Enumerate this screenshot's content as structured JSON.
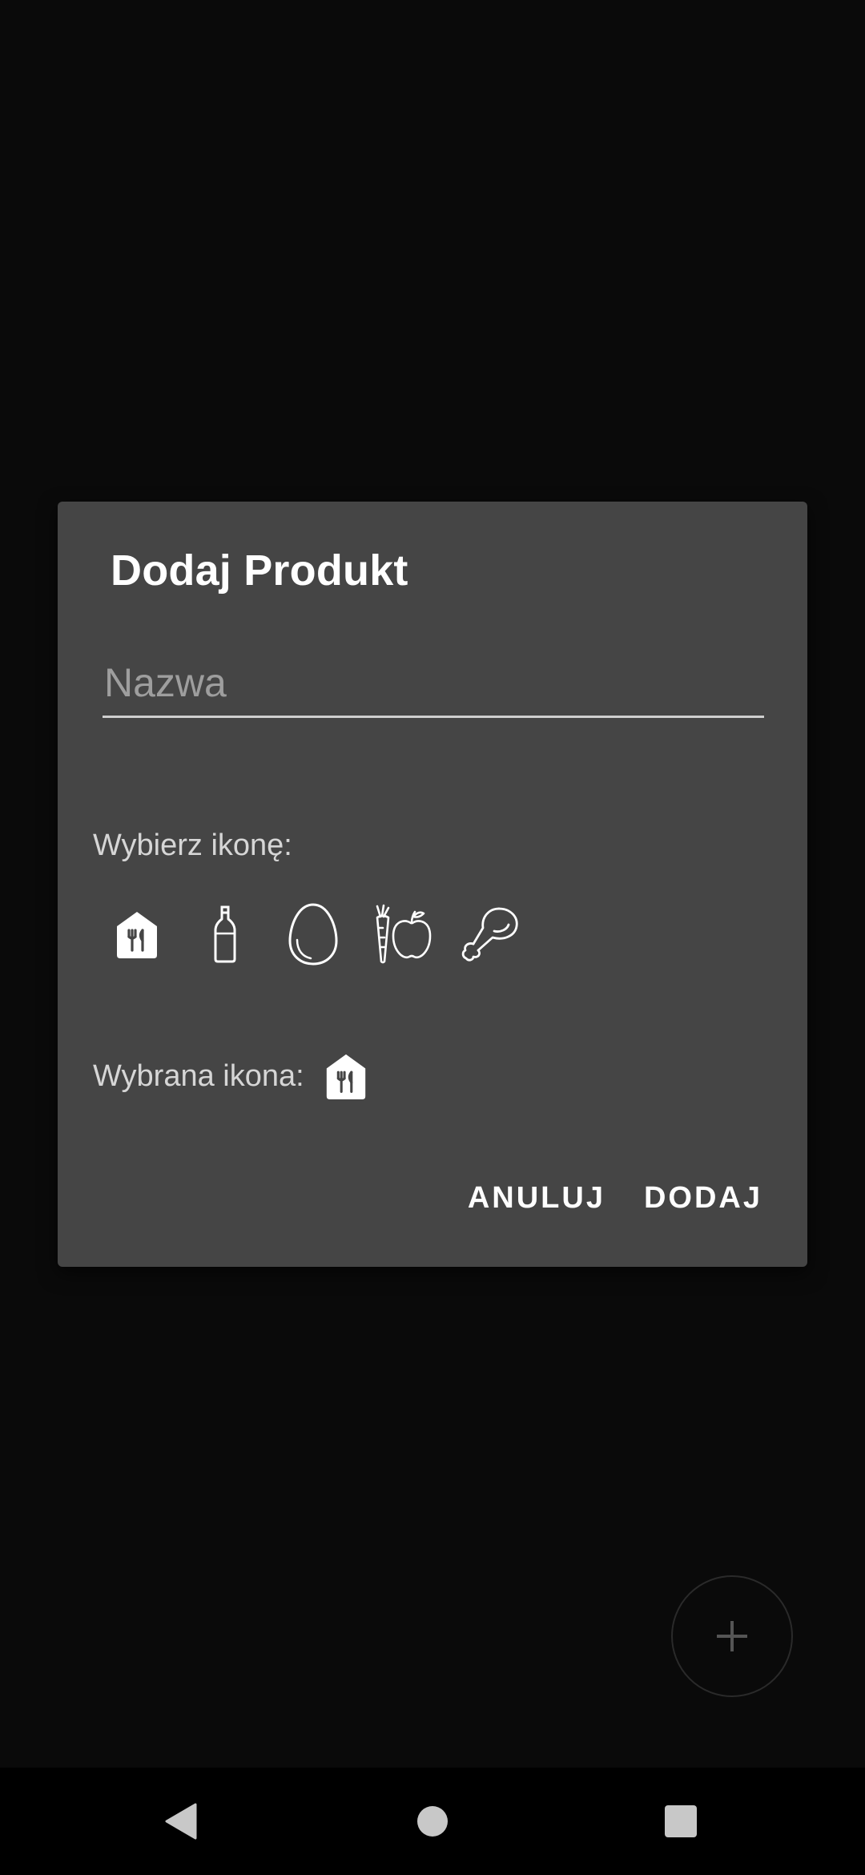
{
  "dialog": {
    "title": "Dodaj Produkt",
    "name_placeholder": "Nazwa",
    "name_value": "",
    "choose_icon_label": "Wybierz ikonę:",
    "icons": [
      "restaurant-icon",
      "bottle-icon",
      "egg-icon",
      "carrot-apple-icon",
      "chicken-leg-icon"
    ],
    "selected_icon_label": "Wybrana ikona:",
    "selected_icon": "restaurant-icon",
    "cancel_label": "ANULUJ",
    "add_label": "DODAJ"
  },
  "fab": {
    "icon": "plus-icon"
  },
  "navbar": {
    "back_icon": "back-triangle-icon",
    "home_icon": "home-circle-icon",
    "recents_icon": "recents-square-icon"
  },
  "colors": {
    "background": "#0a0a0a",
    "dialog": "#454545",
    "text": "#ffffff",
    "muted_text": "#d6d6d6",
    "placeholder": "#9e9e9e"
  }
}
